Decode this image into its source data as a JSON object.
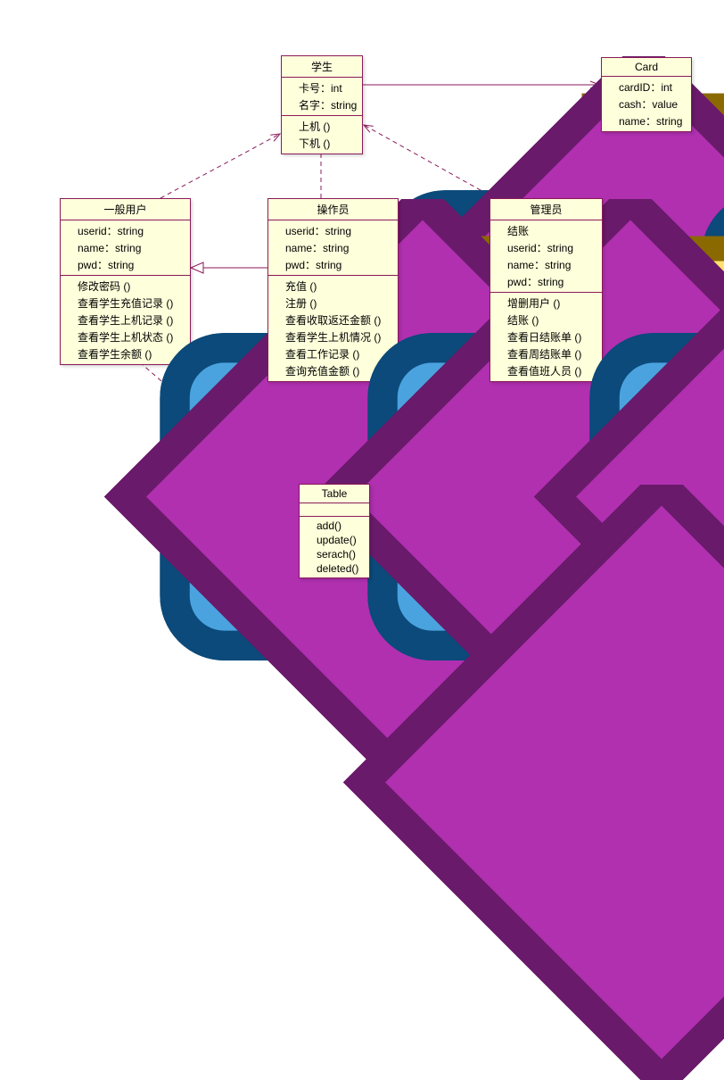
{
  "classes": {
    "student": {
      "name": "学生",
      "attrs": [
        "卡号：int",
        "名字：string"
      ],
      "ops": [
        "上机 ()",
        "下机 ()"
      ]
    },
    "card": {
      "name": "Card",
      "attrs": [
        "cardID：int",
        "cash：value",
        "name：string"
      ],
      "ops": []
    },
    "user": {
      "name": "一般用户",
      "attrs": [
        "userid：string",
        "name：string",
        "pwd：string"
      ],
      "ops": [
        "修改密码 ()",
        "查看学生充值记录 ()",
        "查看学生上机记录 ()",
        "查看学生上机状态 ()",
        "查看学生余额 ()"
      ]
    },
    "operator": {
      "name": "操作员",
      "attrs": [
        "userid：string",
        "name：string",
        "pwd：string"
      ],
      "ops": [
        "充值 ()",
        "注册 ()",
        "查看收取返还金额 ()",
        "查看学生上机情况 ()",
        "查看工作记录 ()",
        "查询充值金额 ()"
      ]
    },
    "admin": {
      "name": "管理员",
      "attrs": [
        "结账",
        "userid：string",
        "name：string",
        "pwd：string"
      ],
      "ops": [
        "增删用户 ()",
        "结账 ()",
        "查看日结账单 ()",
        "查看周结账单 ()",
        "查看值班人员 ()"
      ]
    },
    "table": {
      "name": "Table",
      "attrs": [],
      "ops": [
        "add()",
        "update()",
        "serach()",
        "deleted()"
      ]
    }
  },
  "chart_data": {
    "type": "uml_class_diagram",
    "classes": [
      {
        "id": "student",
        "name": "学生",
        "attributes": [
          {
            "name": "卡号",
            "type": "int"
          },
          {
            "name": "名字",
            "type": "string"
          }
        ],
        "operations": [
          "上机()",
          "下机()"
        ]
      },
      {
        "id": "card",
        "name": "Card",
        "attributes": [
          {
            "name": "cardID",
            "type": "int"
          },
          {
            "name": "cash",
            "type": "value"
          },
          {
            "name": "name",
            "type": "string"
          }
        ],
        "operations": []
      },
      {
        "id": "user",
        "name": "一般用户",
        "attributes": [
          {
            "name": "userid",
            "type": "string"
          },
          {
            "name": "name",
            "type": "string"
          },
          {
            "name": "pwd",
            "type": "string"
          }
        ],
        "operations": [
          "修改密码()",
          "查看学生充值记录()",
          "查看学生上机记录()",
          "查看学生上机状态()",
          "查看学生余额()"
        ]
      },
      {
        "id": "operator",
        "name": "操作员",
        "attributes": [
          {
            "name": "userid",
            "type": "string"
          },
          {
            "name": "name",
            "type": "string"
          },
          {
            "name": "pwd",
            "type": "string"
          }
        ],
        "operations": [
          "充值()",
          "注册()",
          "查看收取返还金额()",
          "查看学生上机情况()",
          "查看工作记录()",
          "查询充值金额()"
        ]
      },
      {
        "id": "admin",
        "name": "管理员",
        "attributes": [
          {
            "name": "结账",
            "type": ""
          },
          {
            "name": "userid",
            "type": "string"
          },
          {
            "name": "name",
            "type": "string"
          },
          {
            "name": "pwd",
            "type": "string"
          }
        ],
        "operations": [
          "增删用户()",
          "结账()",
          "查看日结账单()",
          "查看周结账单()",
          "查看值班人员()"
        ]
      },
      {
        "id": "table",
        "name": "Table",
        "attributes": [],
        "operations": [
          "add()",
          "update()",
          "serach()",
          "deleted()"
        ]
      }
    ],
    "relationships": [
      {
        "from": "student",
        "to": "card",
        "type": "association",
        "style": "solid",
        "arrow": "open"
      },
      {
        "from": "operator",
        "to": "user",
        "type": "generalization",
        "style": "solid",
        "arrow": "hollow_triangle"
      },
      {
        "from": "admin",
        "to": "operator",
        "type": "generalization",
        "style": "solid",
        "arrow": "hollow_triangle"
      },
      {
        "from": "user",
        "to": "student",
        "type": "dependency",
        "style": "dashed",
        "arrow": "open"
      },
      {
        "from": "operator",
        "to": "student",
        "type": "dependency",
        "style": "dashed",
        "arrow": "open"
      },
      {
        "from": "admin",
        "to": "student",
        "type": "dependency",
        "style": "dashed",
        "arrow": "open"
      },
      {
        "from": "user",
        "to": "table",
        "type": "dependency",
        "style": "dashed",
        "arrow": "open"
      },
      {
        "from": "operator",
        "to": "table",
        "type": "dependency",
        "style": "dashed",
        "arrow": "open"
      },
      {
        "from": "admin",
        "to": "table",
        "type": "dependency",
        "style": "dashed",
        "arrow": "open"
      }
    ]
  }
}
